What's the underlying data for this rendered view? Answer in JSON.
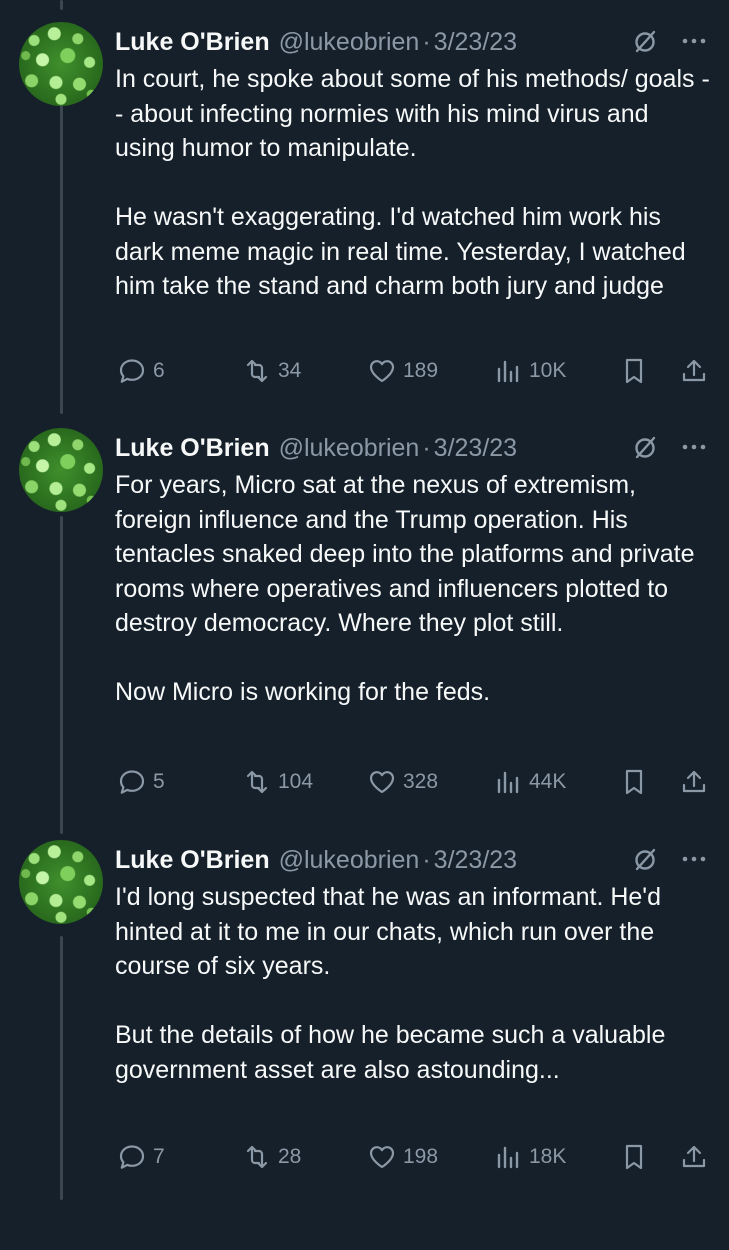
{
  "tweets": [
    {
      "author": "Luke O'Brien",
      "handle": "@lukeobrien",
      "separator": "·",
      "date": "3/23/23",
      "paragraphs": [
        "In court, he spoke about some of his methods/ goals -- about infecting normies with his mind virus and using humor to manipulate.",
        "He wasn't exaggerating. I'd watched him work his dark meme magic in real time. Yesterday, I watched him take the stand and charm both jury and judge"
      ],
      "replies": "6",
      "reposts": "34",
      "likes": "189",
      "views": "10K"
    },
    {
      "author": "Luke O'Brien",
      "handle": "@lukeobrien",
      "separator": "·",
      "date": "3/23/23",
      "paragraphs": [
        "For years, Micro sat at the nexus of extremism, foreign influence and the Trump operation. His tentacles snaked deep into the platforms and private rooms where operatives and influencers plotted to destroy democracy. Where they plot still.",
        "Now Micro is working for the feds."
      ],
      "replies": "5",
      "reposts": "104",
      "likes": "328",
      "views": "44K"
    },
    {
      "author": "Luke O'Brien",
      "handle": "@lukeobrien",
      "separator": "·",
      "date": "3/23/23",
      "paragraphs": [
        "I'd long suspected that he was an informant. He'd hinted at it to me in our chats, which run over the course of six years.",
        "But the details of how he became such a valuable government asset are also astounding..."
      ],
      "replies": "7",
      "reposts": "28",
      "likes": "198",
      "views": "18K"
    }
  ],
  "icons": {
    "reply": "reply-icon",
    "repost": "repost-icon",
    "like": "heart-icon",
    "views": "views-icon",
    "bookmark": "bookmark-icon",
    "share": "share-icon",
    "grok": "grok-icon",
    "more": "more-icon"
  },
  "colors": {
    "background": "#15202b",
    "text": "#f7f9f9",
    "secondary": "#8b98a5",
    "thread_line": "#3c4650"
  }
}
